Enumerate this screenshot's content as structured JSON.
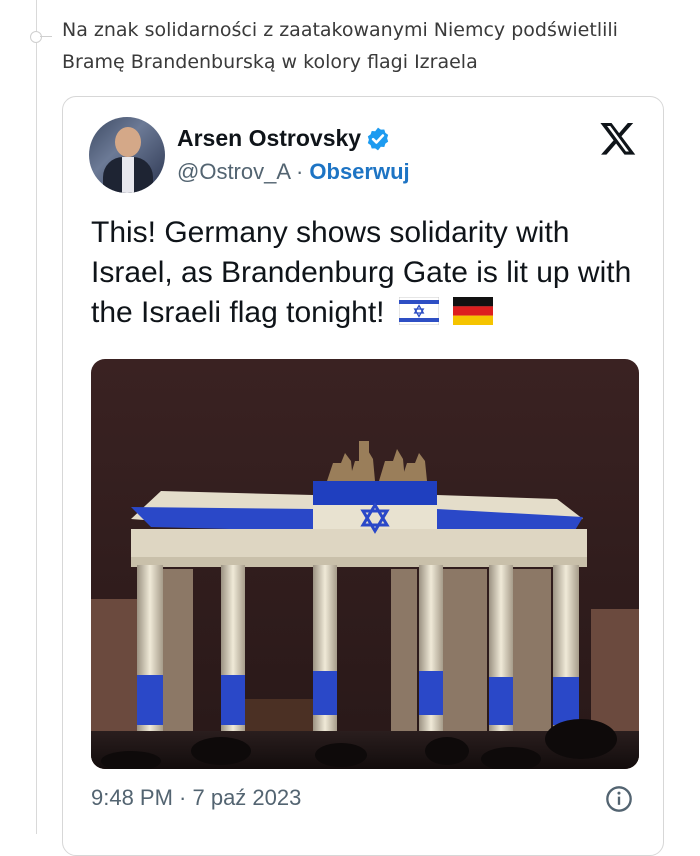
{
  "comment": {
    "text": "Na znak solidarności z zaatakowanymi Niemcy podświetlili Bramę Brandenburską w kolory flagi Izraela"
  },
  "tweet": {
    "author_name": "Arsen Ostrovsky",
    "handle": "@Ostrov_A",
    "separator": " · ",
    "follow_label": "Obserwuj",
    "text": "This! Germany shows solidarity with Israel, as Brandenburg Gate is lit up with the Israeli flag tonight!",
    "flags": [
      "israel-flag-icon",
      "germany-flag-icon"
    ],
    "timestamp": "9:48 PM · 7 paź 2023"
  },
  "icons": {
    "verified": "verified-badge-icon",
    "logo": "x-logo-icon",
    "info": "info-icon"
  },
  "colors": {
    "verified_blue": "#1d9bf0",
    "follow_blue": "#1d74c4",
    "israel_blue": "#2e4fc4"
  }
}
